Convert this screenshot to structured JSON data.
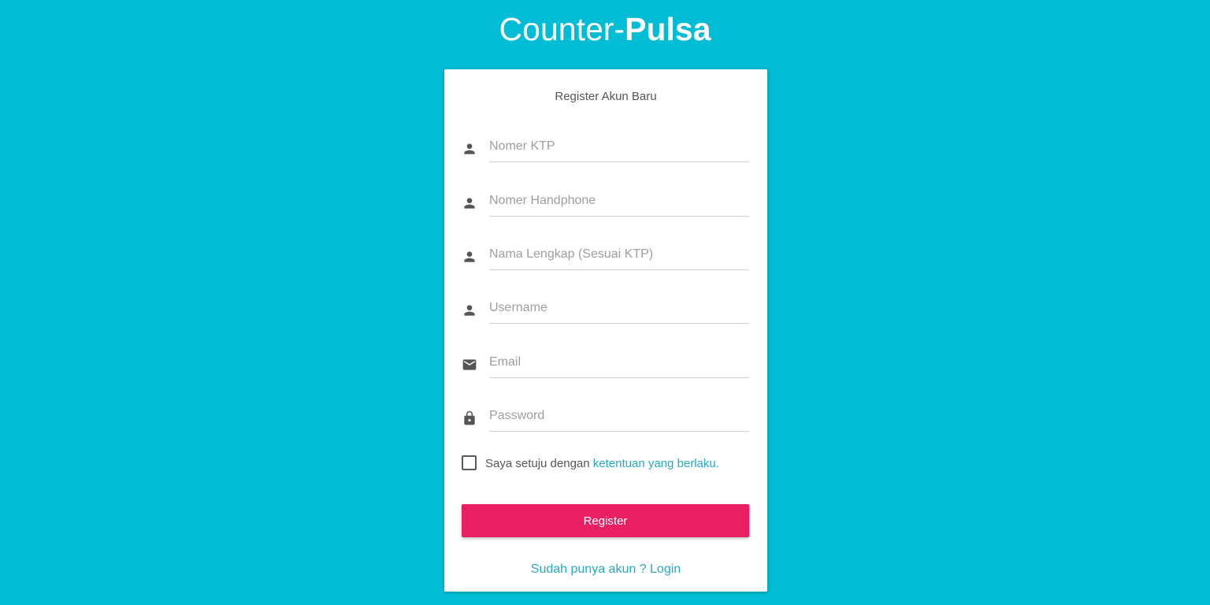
{
  "brand": {
    "name_regular": "Counter-",
    "name_bold": "Pulsa"
  },
  "form": {
    "title": "Register Akun Baru",
    "fields": [
      {
        "icon": "person-icon",
        "placeholder": "Nomer KTP",
        "value": ""
      },
      {
        "icon": "person-icon",
        "placeholder": "Nomer Handphone",
        "value": ""
      },
      {
        "icon": "person-icon",
        "placeholder": "Nama Lengkap (Sesuai KTP)",
        "value": ""
      },
      {
        "icon": "person-icon",
        "placeholder": "Username",
        "value": ""
      },
      {
        "icon": "email-icon",
        "placeholder": "Email",
        "value": ""
      },
      {
        "icon": "lock-icon",
        "placeholder": "Password",
        "value": ""
      }
    ],
    "agreement": {
      "checked": false,
      "text": "Saya setuju dengan ",
      "link_text": "ketentuan yang berlaku."
    },
    "register_label": "Register",
    "login_link": "Sudah punya akun ? Login"
  },
  "colors": {
    "background": "#00BCD4",
    "accent_button": "#E91E63",
    "link": "#26A9C2"
  }
}
